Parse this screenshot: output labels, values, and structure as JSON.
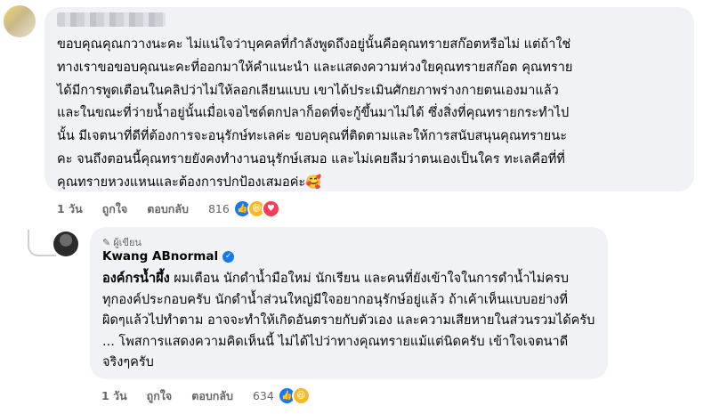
{
  "comment1": {
    "lines": [
      "ขอบคุณคุณกวางนะคะ ไม่แน่ใจว่าบุคคลที่กำลังพูดถึงอยู่นั้นคือคุณทรายสก๊อตหรือไม่ แต่ถ้าใช่",
      "ทางเราขอขอบคุณนะคะที่ออกมาให้คำแนะนำ และแสดงความห่วงใยคุณทรายสก๊อต คุณทราย",
      "ได้มีการพูดเตือนในคลิปว่าไม่ให้ลอกเลียนแบบ เขาได้ประเมินศักยภาพร่างกายตนเองมาแล้ว",
      "และในขณะที่ว่ายน้ำอยู่นั้นเมื่อเจอไซด์ตกปลาก็อดที่จะกู้ขึ้นมาไม่ได้ ซึ่งสิ่งที่คุณทรายกระทำไป",
      "นั้น มีเจตนาที่ดีที่ต้องการจะอนุรักษ์ทะเลค่ะ ขอบคุณที่ติดตามและให้การสนับสนุนคุณทรายนะ",
      "คะ จนถึงตอนนี้คุณทรายยังคงทำงานอนุรักษ์เสมอ และไม่เคยลืมว่าตนเองเป็นใคร ทะเลคือที่ที่",
      "คุณทรายหวงแหนและต้องการปกป้องเสมอค่ะ🥰"
    ],
    "time": "1 วัน",
    "like_label": "ถูกใจ",
    "reply_label": "ตอบกลับ",
    "reaction_count": "816"
  },
  "comment2": {
    "author_tag": "ผู้เขียน",
    "author_name": "Kwang ABnormal",
    "first_bold": "องค์กรน้ำผึ้ง",
    "first_rest": " ผมเตือน นักดำน้ำมือใหม่ นักเรียน และคนที่ยังเข้าใจในการดำน้ำไม่ครบ",
    "lines": [
      "ทุกองค์ประกอบครับ นักดำน้ำส่วนใหญ่มีใจอยากอนุรักษ์อยู่แล้ว ถ้าเค้าเห็นแบบอย่างที่",
      "ผิดๆแล้วไปทำตาม อาจจะทำให้เกิดอันตรายกับตัวเอง และความเสียหายในส่วนรวมได้ครับ",
      "... โพสการแสดงความคิดเห็นนี้ ไม่ได้ไปว่าทางคุณทรายแม้แต่นิดครับ เข้าใจเจตนาดี",
      "จริงๆครับ"
    ],
    "time": "1 วัน",
    "like_label": "ถูกใจ",
    "reply_label": "ตอบกลับ",
    "reaction_count": "634"
  },
  "icons": {
    "like": "👍",
    "haha": "😆",
    "love": "♥",
    "verified": "✓",
    "pen": "✎"
  },
  "colors": {
    "bubble": "#f0f2f5",
    "meta_text": "#65676b",
    "like_blue": "#1877f2",
    "haha_yellow": "#f7b928",
    "love_red": "#f33e58"
  }
}
